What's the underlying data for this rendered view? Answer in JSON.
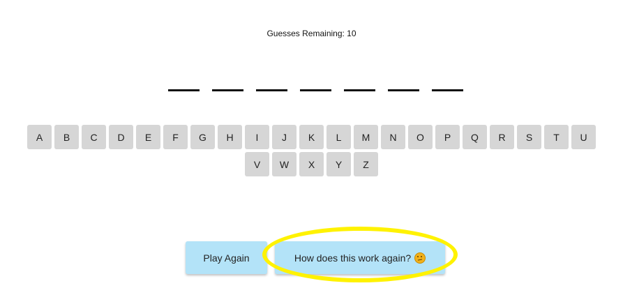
{
  "status": {
    "guesses_label": "Guesses Remaining: 10"
  },
  "word": {
    "blank_count": 7
  },
  "keyboard": {
    "rows": [
      [
        "A",
        "B",
        "C",
        "D",
        "E",
        "F",
        "G",
        "H",
        "I",
        "J",
        "K",
        "L",
        "M",
        "N",
        "O",
        "P",
        "Q",
        "R",
        "S",
        "T",
        "U"
      ],
      [
        "V",
        "W",
        "X",
        "Y",
        "Z"
      ]
    ]
  },
  "buttons": {
    "play_again": "Play Again",
    "how_works": "How does this work again?",
    "how_works_icon": "thinking-face-icon"
  },
  "colors": {
    "key_bg": "#d6d6d6",
    "button_bg": "#b3e3f8",
    "highlight": "#fff200"
  }
}
